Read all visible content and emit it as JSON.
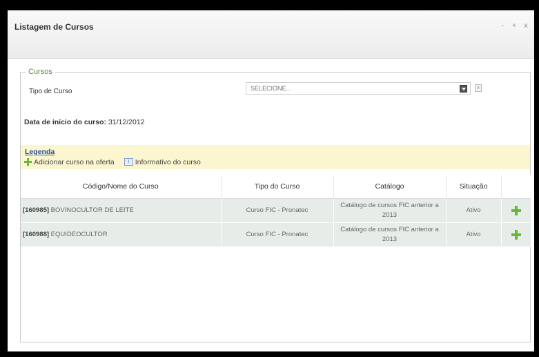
{
  "window": {
    "title": "Listagem de Cursos",
    "controls": [
      "-",
      "+",
      "x"
    ]
  },
  "fieldset": {
    "legend": "Cursos",
    "tipo_label": "Tipo de Curso",
    "select_value": "SELECIONE...",
    "clear_label": "x",
    "data_inicio_label": "Data de início do curso:",
    "data_inicio_value": "31/12/2012"
  },
  "legenda": {
    "title": "Legenda",
    "add_label": "Adicionar curso na oferta",
    "info_label": "Informativo do curso",
    "info_icon_glyph": "i"
  },
  "table": {
    "headers": [
      "Código/Nome do Curso",
      "Tipo do Curso",
      "Catálogo",
      "Situação",
      ""
    ],
    "rows": [
      {
        "code": "[160985]",
        "name": "BOVINOCULTOR DE LEITE",
        "tipo": "Curso FIC - Pronatec",
        "catalogo": "Catálogo de cursos FIC anterior a 2013",
        "situacao": "Ativo"
      },
      {
        "code": "[160988]",
        "name": "EQUIDEOCULTOR",
        "tipo": "Curso FIC - Pronatec",
        "catalogo": "Catálogo de cursos FIC anterior a 2013",
        "situacao": "Ativo"
      }
    ]
  },
  "colors": {
    "legend_green": "#4b8f3a",
    "plus_green": "#6ab73c",
    "legenda_bg": "#fbf6cf",
    "row_bg": "#e6ece8"
  }
}
